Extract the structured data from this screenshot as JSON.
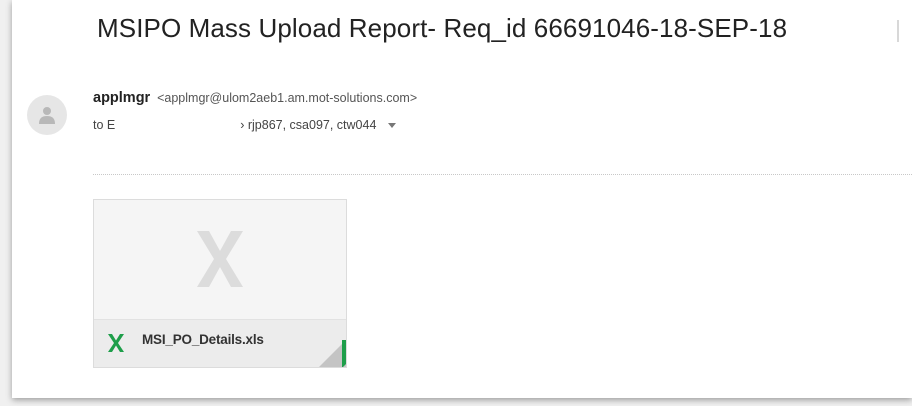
{
  "email": {
    "subject": "MSIPO Mass Upload Report- Req_id 66691046-18-SEP-18",
    "sender": {
      "name": "applmgr",
      "email": "<applmgr@ulom2aeb1.am.mot-solutions.com>"
    },
    "recipients": {
      "prefix": "to E",
      "after_redaction": "› rjp867, csa097, ctw044"
    },
    "attachment": {
      "filename": "MSI_PO_Details.xls",
      "icon": "excel-icon"
    }
  },
  "colors": {
    "excel_green": "#1e9e4a",
    "avatar_bg": "#e6e6e6"
  }
}
